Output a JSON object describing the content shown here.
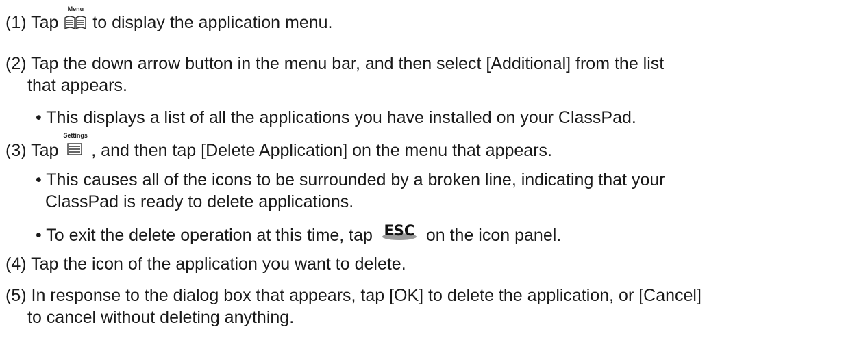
{
  "steps": [
    {
      "number": "(1)",
      "text_before": "Tap",
      "icon": {
        "name": "menu-icon",
        "caption": "Menu"
      },
      "text_after": "to display the application menu."
    },
    {
      "number": "(2)",
      "lines": [
        "Tap the down arrow button in the menu bar, and then select [Additional] from the list",
        "that appears."
      ],
      "bullets": [
        {
          "lines": [
            "This displays a list of all the applications you have installed on your ClassPad."
          ]
        }
      ]
    },
    {
      "number": "(3)",
      "text_before": "Tap",
      "icon": {
        "name": "settings-icon",
        "caption": "Settings"
      },
      "text_after": ", and then tap [Delete Application] on the menu that appears.",
      "bullets": [
        {
          "lines": [
            "This causes all of the icons to be surrounded by a broken line, indicating that your",
            "ClassPad is ready to delete applications."
          ]
        },
        {
          "text_before": "To exit the delete operation at this time, tap",
          "icon": {
            "name": "esc-icon",
            "caption": "ESC"
          },
          "text_after": "on the icon panel."
        }
      ]
    },
    {
      "number": "(4)",
      "lines": [
        "Tap the icon of the application you want to delete."
      ]
    },
    {
      "number": "(5)",
      "lines": [
        "In response to the dialog box that appears, tap [OK] to delete the application, or [Cancel]",
        "to cancel without deleting anything."
      ]
    }
  ],
  "bullet_char": "•"
}
